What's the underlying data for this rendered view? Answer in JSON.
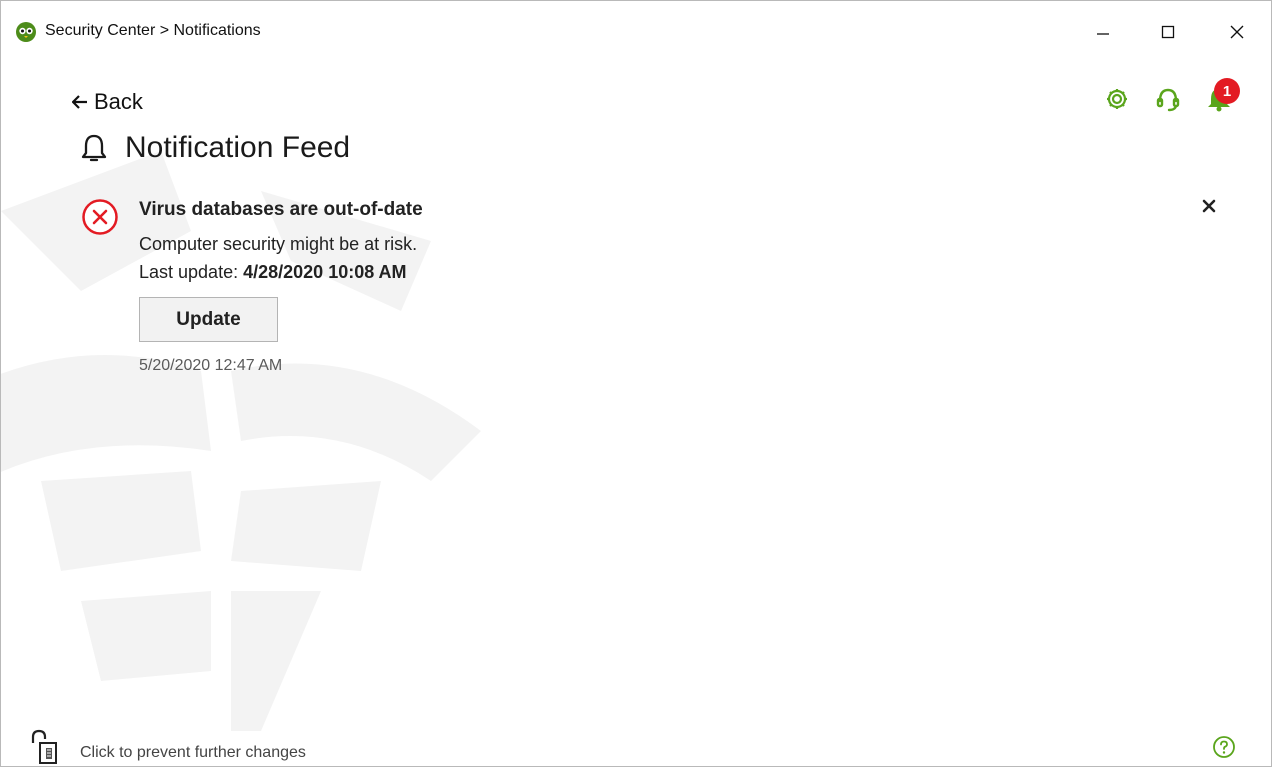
{
  "window": {
    "title": "Security Center > Notifications"
  },
  "nav": {
    "back_label": "Back"
  },
  "header": {
    "notification_count": "1"
  },
  "page": {
    "title": "Notification Feed"
  },
  "notification": {
    "title": "Virus databases are out-of-date",
    "description": "Computer security might be at risk.",
    "last_update_label": "Last update:",
    "last_update_value": "4/28/2020 10:08 AM",
    "action_label": "Update",
    "timestamp": "5/20/2020 12:47 AM"
  },
  "footer": {
    "lock_label": "Click to prevent further changes"
  },
  "colors": {
    "accent_green": "#5aa51c",
    "error_red": "#e31b23",
    "badge_red": "#e31b23"
  }
}
